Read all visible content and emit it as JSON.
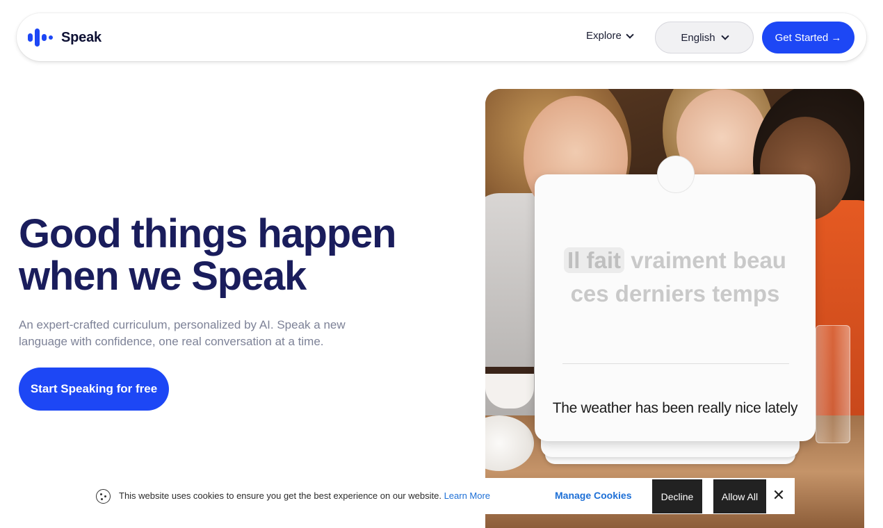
{
  "nav": {
    "brand": "Speak",
    "explore_label": "Explore",
    "language_label": "English",
    "get_started_label": "Get Started →"
  },
  "hero": {
    "title_line1": "Good things happen",
    "title_line2": "when we Speak",
    "subtitle": "An expert-crafted curriculum, personalized by AI. Speak a new language with confidence, one real conversation at a time.",
    "cta_label": "Start Speaking for free"
  },
  "card": {
    "french_highlight": "Il fait",
    "french_rest_line1": "vraiment beau",
    "french_line2": "ces derniers temps",
    "english": "The weather has been really nice lately"
  },
  "cookie": {
    "text": "This website uses cookies to ensure you get the best experience on our website.",
    "learn_more": "Learn More",
    "manage": "Manage Cookies",
    "decline": "Decline",
    "allow_all": "Allow All",
    "close": "✕"
  },
  "colors": {
    "brand_blue": "#1d47f5",
    "headline": "#1a1d5c",
    "link_blue": "#1d6fd6"
  },
  "icons": [
    "speak-logo-icon",
    "chevron-down-icon",
    "arrow-right-icon",
    "cookie-icon",
    "close-icon"
  ]
}
